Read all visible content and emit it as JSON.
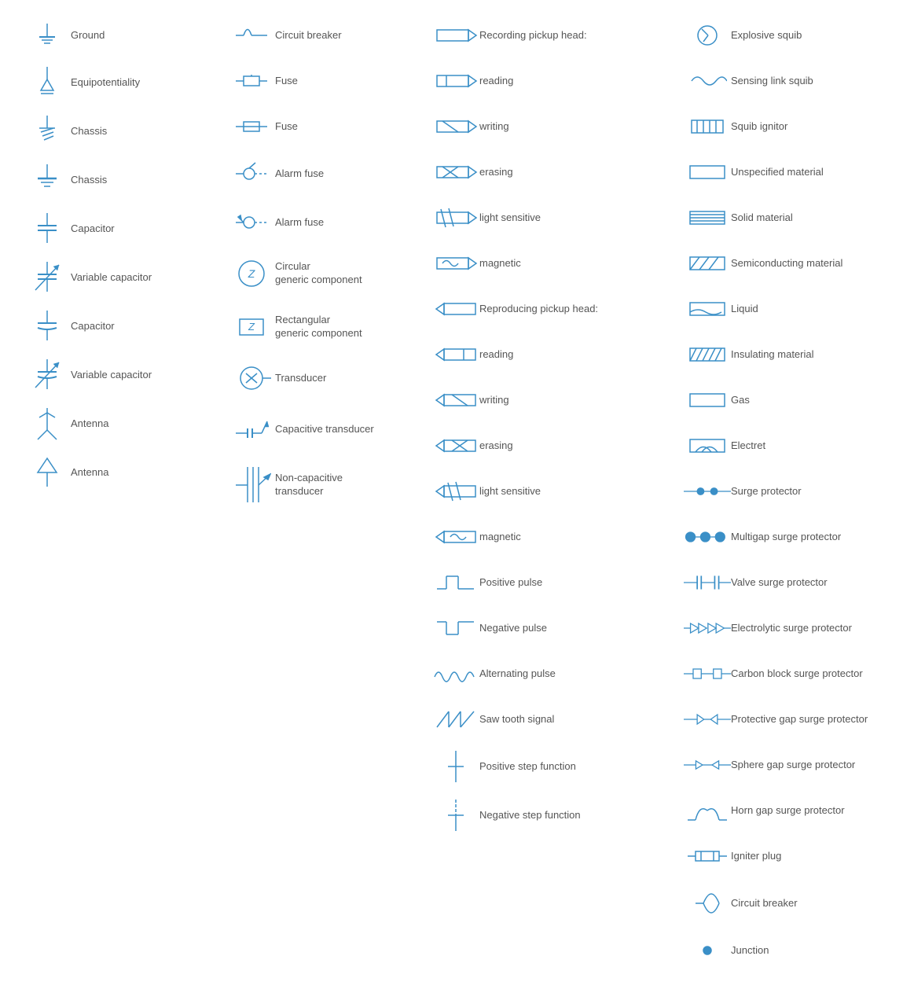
{
  "col1": {
    "items": [
      {
        "label": "Ground"
      },
      {
        "label": "Equipotentiality"
      },
      {
        "label": "Chassis"
      },
      {
        "label": "Chassis"
      },
      {
        "label": "Capacitor"
      },
      {
        "label": "Variable capacitor"
      },
      {
        "label": "Capacitor"
      },
      {
        "label": "Variable capacitor"
      },
      {
        "label": "Antenna"
      },
      {
        "label": "Antenna"
      }
    ]
  },
  "col2": {
    "items": [
      {
        "label": "Circuit breaker"
      },
      {
        "label": "Fuse"
      },
      {
        "label": "Fuse"
      },
      {
        "label": "Alarm fuse"
      },
      {
        "label": "Alarm fuse"
      },
      {
        "label": "Circular\ngeneric component"
      },
      {
        "label": "Rectangular\ngeneric component"
      },
      {
        "label": "Transducer"
      },
      {
        "label": "Capacitive transducer"
      },
      {
        "label": "Non-capacitive\ntransducer"
      }
    ]
  },
  "col3": {
    "items": [
      {
        "label": "Recording pickup head:"
      },
      {
        "label": "reading"
      },
      {
        "label": "writing"
      },
      {
        "label": "erasing"
      },
      {
        "label": "light sensitive"
      },
      {
        "label": "magnetic"
      },
      {
        "label": "Reproducing pickup head:"
      },
      {
        "label": "reading"
      },
      {
        "label": "writing"
      },
      {
        "label": "erasing"
      },
      {
        "label": "light sensitive"
      },
      {
        "label": "magnetic"
      },
      {
        "label": "Positive pulse"
      },
      {
        "label": "Negative pulse"
      },
      {
        "label": "Alternating pulse"
      },
      {
        "label": "Saw tooth signal"
      },
      {
        "label": "Positive step function"
      },
      {
        "label": "Negative step function"
      }
    ]
  },
  "col4": {
    "items": [
      {
        "label": "Explosive squib"
      },
      {
        "label": "Sensing link squib"
      },
      {
        "label": "Squib ignitor"
      },
      {
        "label": "Unspecified material"
      },
      {
        "label": "Solid material"
      },
      {
        "label": "Semiconducting material"
      },
      {
        "label": "Liquid"
      },
      {
        "label": "Insulating material"
      },
      {
        "label": "Gas"
      },
      {
        "label": "Electret"
      },
      {
        "label": "Surge protector"
      },
      {
        "label": "Multigap surge protector"
      },
      {
        "label": "Valve surge protector"
      },
      {
        "label": "Electrolytic surge protector"
      },
      {
        "label": "Carbon block surge protector"
      },
      {
        "label": "Protective gap surge protector"
      },
      {
        "label": "Sphere gap surge protector"
      },
      {
        "label": "Horn gap surge protector"
      },
      {
        "label": "Igniter plug"
      },
      {
        "label": "Circuit breaker"
      },
      {
        "label": "Junction"
      }
    ]
  }
}
